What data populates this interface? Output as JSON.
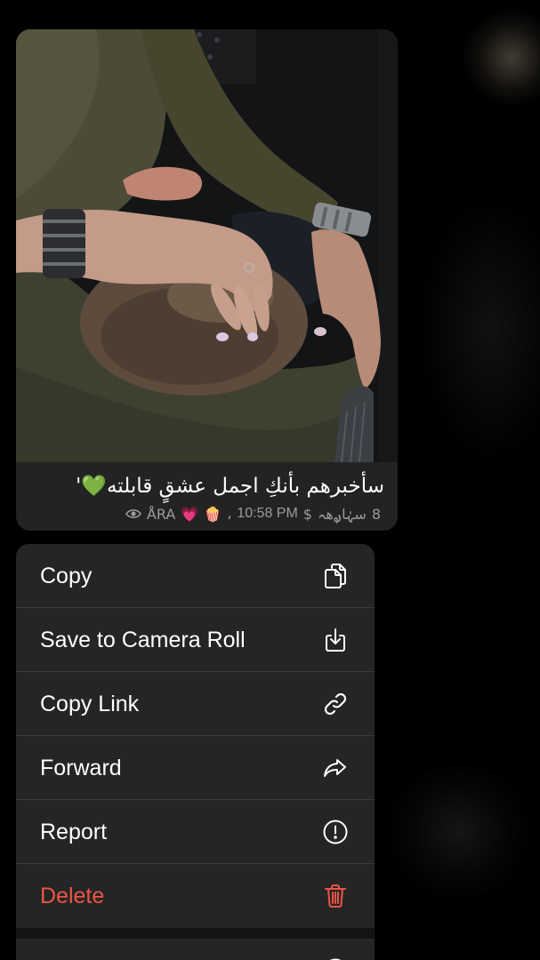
{
  "message": {
    "caption": "سأخبرهم بأنكِ اجمل عشقٍ قابلته💚'",
    "meta": {
      "views_icon": "eye-icon",
      "signature": "ÅRA",
      "emoji_1": "💗",
      "emoji_2": "🍿",
      "comma": "،",
      "time": "10:58 PM",
      "mark": "$",
      "author": "سہٰاࢪهہ",
      "count": "8"
    }
  },
  "menu": {
    "items": [
      {
        "label": "Copy",
        "icon": "copy-icon"
      },
      {
        "label": "Save to Camera Roll",
        "icon": "download-icon"
      },
      {
        "label": "Copy Link",
        "icon": "link-icon"
      },
      {
        "label": "Forward",
        "icon": "forward-icon"
      },
      {
        "label": "Report",
        "icon": "report-icon"
      },
      {
        "label": "Delete",
        "icon": "trash-icon",
        "destructive": true
      }
    ],
    "next_section_icon": "circle-icon"
  },
  "colors": {
    "menu_background": "#252525",
    "bubble_background": "#232323",
    "destructive": "#eb5545",
    "meta_text": "#9b9b9b"
  }
}
